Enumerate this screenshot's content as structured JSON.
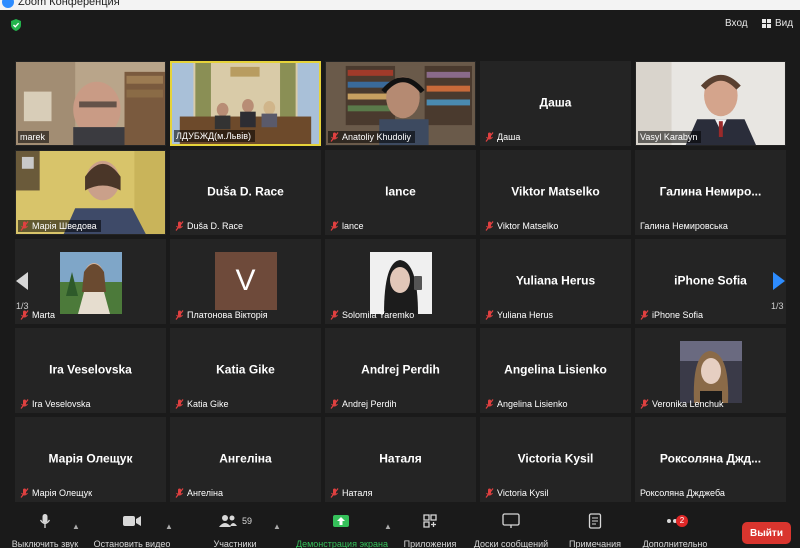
{
  "window": {
    "title": "Zoom Конференция"
  },
  "top": {
    "enter_label": "Вход",
    "view_label": "Вид"
  },
  "pager": {
    "left": "1/3",
    "right": "1/3"
  },
  "tiles": [
    {
      "name": "marek",
      "display": "",
      "muted": false,
      "type": "video"
    },
    {
      "name": "ЛДУБЖД(м.Львів)",
      "display": "",
      "muted": false,
      "type": "video"
    },
    {
      "name": "Anatoliy Khudoliy",
      "display": "",
      "muted": true,
      "type": "video"
    },
    {
      "name": "Даша",
      "display": "Даша",
      "muted": true,
      "type": "name"
    },
    {
      "name": "Vasyl Karabyn",
      "display": "",
      "muted": false,
      "type": "video"
    },
    {
      "name": "Марія Шведова",
      "display": "",
      "muted": true,
      "type": "video"
    },
    {
      "name": "Duša D. Race",
      "display": "Duša D. Race",
      "muted": true,
      "type": "name"
    },
    {
      "name": "lance",
      "display": "lance",
      "muted": true,
      "type": "name"
    },
    {
      "name": "Viktor Matselko",
      "display": "Viktor Matselko",
      "muted": true,
      "type": "name"
    },
    {
      "name": "Галина Немировська",
      "display": "Галина  Немиро...",
      "muted": false,
      "type": "name"
    },
    {
      "name": "Marta",
      "display": "",
      "muted": true,
      "type": "photo"
    },
    {
      "name": "Платонова Вікторія",
      "display": "V",
      "muted": true,
      "type": "avatar"
    },
    {
      "name": "Solomiia Yaremko",
      "display": "",
      "muted": true,
      "type": "photo"
    },
    {
      "name": "Yuliana Herus",
      "display": "Yuliana Herus",
      "muted": true,
      "type": "name"
    },
    {
      "name": "iPhone Sofia",
      "display": "iPhone Sofia",
      "muted": true,
      "type": "name"
    },
    {
      "name": "Ira Veselovska",
      "display": "Ira Veselovska",
      "muted": true,
      "type": "name"
    },
    {
      "name": "Katia Gike",
      "display": "Katia Gike",
      "muted": true,
      "type": "name"
    },
    {
      "name": "Andrej Perdih",
      "display": "Andrej Perdih",
      "muted": true,
      "type": "name"
    },
    {
      "name": "Angelina Lisienko",
      "display": "Angelina Lisienko",
      "muted": true,
      "type": "name"
    },
    {
      "name": "Veronika Lenchuk",
      "display": "",
      "muted": true,
      "type": "photo"
    },
    {
      "name": "Марія Олещук",
      "display": "Марія Олещук",
      "muted": true,
      "type": "name"
    },
    {
      "name": "Ангеліна",
      "display": "Ангеліна",
      "muted": true,
      "type": "name"
    },
    {
      "name": "Наталя",
      "display": "Наталя",
      "muted": true,
      "type": "name"
    },
    {
      "name": "Victoria Kysil",
      "display": "Victoria Kysil",
      "muted": true,
      "type": "name"
    },
    {
      "name": "Роксоляна Джджеба",
      "display": "Роксоляна  Джд...",
      "muted": false,
      "type": "name"
    }
  ],
  "toolbar": {
    "mute": "Выключить звук",
    "video": "Остановить видео",
    "participants": "Участники",
    "participants_count": "59",
    "share": "Демонстрация экрана",
    "apps": "Приложения",
    "whiteboards": "Доски сообщений",
    "notes": "Примечания",
    "more": "Дополнительно",
    "more_badge": "2",
    "leave": "Выйти"
  },
  "colors": {
    "active_speaker": "#e6d33a",
    "share_green": "#35c05a",
    "leave_red": "#d9352e",
    "zoom_blue": "#2d8cff"
  }
}
